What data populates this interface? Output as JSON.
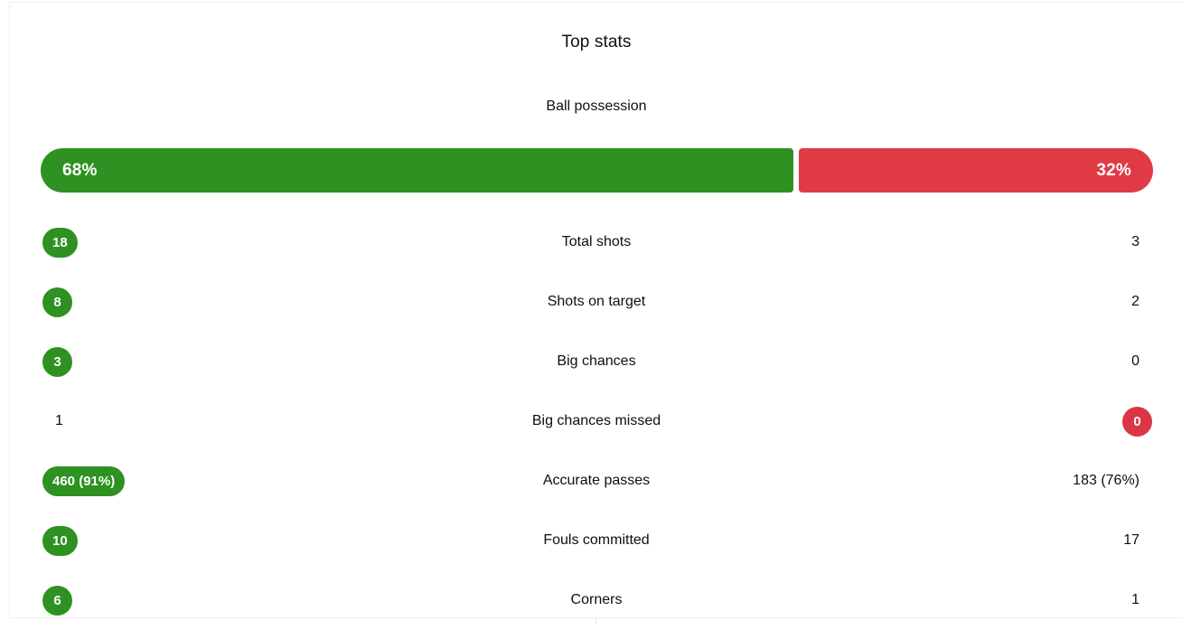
{
  "card": {
    "title": "Top stats"
  },
  "possession": {
    "label": "Ball possession",
    "home_value": "68%",
    "away_value": "32%",
    "home_pct": 68,
    "away_pct": 32,
    "home_color": "#2e9121",
    "away_color": "#e03a45"
  },
  "colors": {
    "green": "#2e9121",
    "red": "#dc3545",
    "text": "#0f0f0f",
    "white": "#ffffff"
  },
  "rows": [
    {
      "label": "Total shots",
      "home": "18",
      "away": "3",
      "home_style": "badge-green",
      "away_style": "plain"
    },
    {
      "label": "Shots on target",
      "home": "8",
      "away": "2",
      "home_style": "badge-green",
      "away_style": "plain"
    },
    {
      "label": "Big chances",
      "home": "3",
      "away": "0",
      "home_style": "badge-green",
      "away_style": "plain"
    },
    {
      "label": "Big chances missed",
      "home": "1",
      "away": "0",
      "home_style": "plain",
      "away_style": "badge-red"
    },
    {
      "label": "Accurate passes",
      "home": "460 (91%)",
      "away": "183 (76%)",
      "home_style": "badge-green",
      "away_style": "plain"
    },
    {
      "label": "Fouls committed",
      "home": "10",
      "away": "17",
      "home_style": "badge-green",
      "away_style": "plain"
    },
    {
      "label": "Corners",
      "home": "6",
      "away": "1",
      "home_style": "badge-green",
      "away_style": "plain"
    }
  ]
}
